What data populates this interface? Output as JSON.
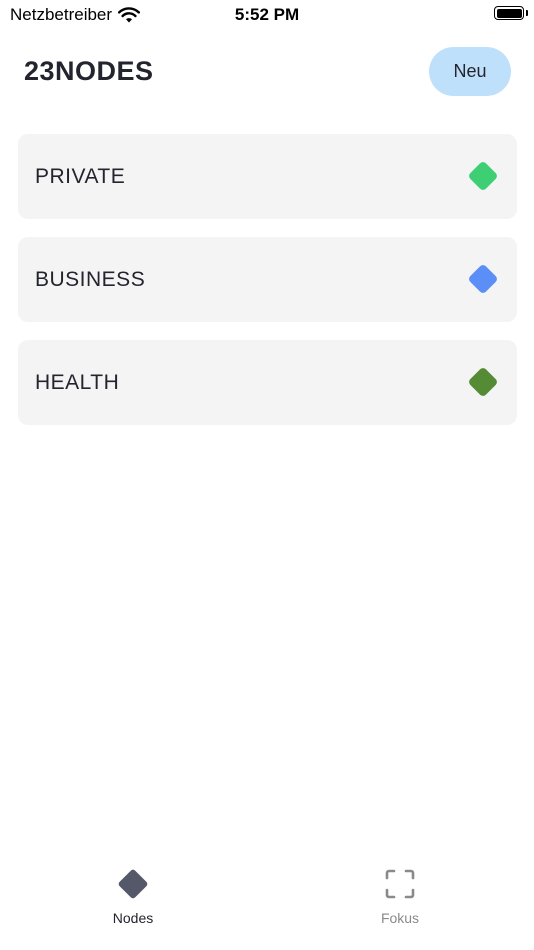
{
  "status_bar": {
    "carrier": "Netzbetreiber",
    "time": "5:52 PM",
    "wifi_icon": "wifi-icon",
    "battery_icon": "battery-icon"
  },
  "header": {
    "title": "23NODES",
    "new_button_label": "Neu"
  },
  "nodes": [
    {
      "label": "PRIVATE",
      "color": "#3ecf74"
    },
    {
      "label": "BUSINESS",
      "color": "#5b8ef7"
    },
    {
      "label": "HEALTH",
      "color": "#558b35"
    }
  ],
  "tab_bar": {
    "tabs": [
      {
        "label": "Nodes",
        "icon": "diamond-icon",
        "active": true
      },
      {
        "label": "Fokus",
        "icon": "focus-frame-icon",
        "active": false
      }
    ]
  },
  "colors": {
    "accent_button": "#bfe0fb",
    "card_background": "#f4f4f4",
    "text_primary": "#24242e"
  }
}
